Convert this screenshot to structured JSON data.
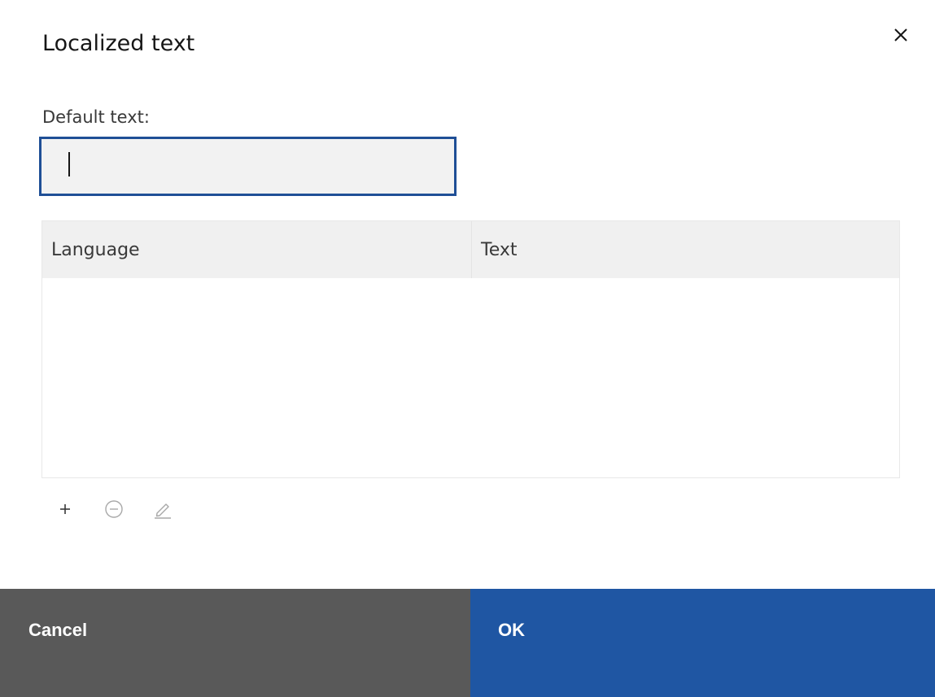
{
  "dialog": {
    "title": "Localized text",
    "default_text_label": "Default text:",
    "default_text_value": "",
    "table": {
      "columns": [
        "Language",
        "Text"
      ],
      "rows": []
    },
    "toolbar": {
      "icons": [
        "plus-icon",
        "minus-circle-icon",
        "pencil-icon"
      ]
    },
    "footer": {
      "cancel_label": "Cancel",
      "ok_label": "OK"
    },
    "colors": {
      "primary": "#1f56a3",
      "secondary": "#595959",
      "focus_border": "#1f4f96"
    }
  }
}
